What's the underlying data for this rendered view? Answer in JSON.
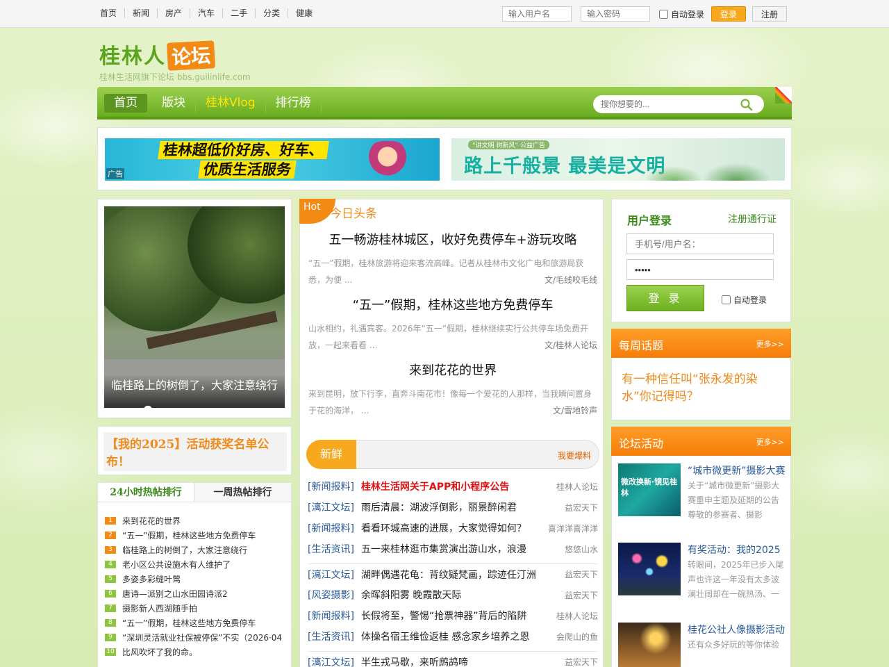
{
  "topbar": {
    "nav": [
      "首页",
      "新闻",
      "房产",
      "汽车",
      "二手",
      "分类",
      "健康"
    ],
    "username_placeholder": "输入用户名",
    "password_placeholder": "输入密码",
    "auto_login": "自动登录",
    "login": "登录",
    "register": "注册"
  },
  "logo": {
    "name": "桂林人",
    "badge": "论坛",
    "subtitle": "桂林生活网旗下论坛",
    "domain": "bbs.guilinlife.com"
  },
  "mainnav": {
    "items": [
      "首页",
      "版块",
      "桂林Vlog",
      "排行榜"
    ],
    "search_placeholder": "搜你想要的..."
  },
  "ads": {
    "ad1_line1": "桂林超低价好房、好车、",
    "ad1_line2": "优质生活服务",
    "ad1_tag": "广告",
    "ad2_caption": "“讲文明 树新风” 公益广告",
    "ad2_text": "路上千般景  最美是文明"
  },
  "slider": {
    "caption": "临桂路上的树倒了，大家注意绕行",
    "dots": 8,
    "active_dot": 2
  },
  "activity_banner": "【我的2025】活动获奖名单公布！",
  "hotlist": {
    "tabs": [
      "24小时热帖排行",
      "一周热帖排行"
    ],
    "items": [
      {
        "n": "1",
        "t": "来到花花的世界"
      },
      {
        "n": "2",
        "t": "“五一”假期，桂林这些地方免费停车"
      },
      {
        "n": "3",
        "t": "临桂路上的树倒了，大家注意绕行"
      },
      {
        "n": "4",
        "t": "老小区公共设施木有人维护了"
      },
      {
        "n": "5",
        "t": "多姿多彩缝叶莺"
      },
      {
        "n": "6",
        "t": "唐诗—派别之山水田园诗派2"
      },
      {
        "n": "7",
        "t": "摄影新人西湖随手拍"
      },
      {
        "n": "8",
        "t": "“五一”假期，桂林这些地方免费停车"
      },
      {
        "n": "9",
        "t": "“深圳灵活就业社保被停保”不实（2026·04"
      },
      {
        "n": "10",
        "t": "比风吹坏了我的命。"
      }
    ]
  },
  "headlines": {
    "badge": "Hot",
    "title": "今日头条",
    "items": [
      {
        "title": "五一畅游桂林城区，收好免费停车+游玩攻略",
        "desc": "“五一”假期，桂林旅游将迎来客流高峰。记者从桂林市文化广电和旅游局获悉，为便 ...",
        "author": "文/毛线咬毛线"
      },
      {
        "title": "“五一”假期，桂林这些地方免费停车",
        "desc": "山水相约，礼遇宾客。2026年“五一”假期，桂林继续实行公共停车场免费开放，一起来看看 ...",
        "author": "文/桂林人论坛"
      },
      {
        "title": "来到花花的世界",
        "desc": "来到昆明，放下行李，直奔斗南花市！像每一个爱花的人那样，当我瞬间置身于花的海洋， ...",
        "author": "文/雪地铃声"
      }
    ]
  },
  "fresh": {
    "label": "新鲜",
    "link": "我要爆料"
  },
  "posts": [
    {
      "cat": "[新闻报料]",
      "title": "桂林生活网关于APP和小程序公告",
      "author": "桂林人论坛",
      "red": true
    },
    {
      "cat": "[漓江文坛]",
      "title": "雨后清晨：湖波浮倒影，丽景醉闲君",
      "author": "益宏天下"
    },
    {
      "cat": "[新闻报料]",
      "title": "看看环城高速的进展，大家觉得如何？",
      "author": "喜洋洋喜洋洋"
    },
    {
      "cat": "[生活资讯]",
      "title": "五一来桂林逛市集赏演出游山水，浪漫",
      "author": "悠悠山水"
    },
    {
      "cat": "[漓江文坛]",
      "title": "湖畔偶遇花龟：背纹疑梵画，踪迹任汀洲",
      "author": "益宏天下"
    },
    {
      "cat": "[风姿摄影]",
      "title": "余晖斜阳雾 晚霞散天际",
      "author": "益宏天下"
    },
    {
      "cat": "[新闻报料]",
      "title": "长假将至，警惕“抢票神器”背后的陷阱",
      "author": "桂林人论坛"
    },
    {
      "cat": "[生活资讯]",
      "title": "体操名宿王维俭返桂 感念家乡培养之恩",
      "author": "会爬山的鱼"
    },
    {
      "cat": "[漓江文坛]",
      "title": "半生戎马歇，来听鹧鸪啼",
      "author": "益宏天下"
    }
  ],
  "login": {
    "title": "用户登录",
    "register": "注册通行证",
    "username_placeholder": "手机号/用户名：",
    "password_value": "•••••",
    "button": "登 录",
    "auto_login": "自动登录"
  },
  "weekly": {
    "title": "每周话题",
    "more": "更多>>",
    "topic": "有一种信任叫“张永发的染水”你记得吗？"
  },
  "forum_activity": {
    "title": "论坛活动",
    "more": "更多>>",
    "items": [
      {
        "title": "“城市微更新”摄影大赛",
        "desc": "关于“城市微更新”摄影大赛重申主题及延期的公告 尊敬的参赛者、摄影",
        "pic_text": "微改换新·镜见桂林"
      },
      {
        "title": "有奖活动：我的2025",
        "desc": "转眼间，2025年已步入尾声也许这一年没有太多波澜壮阔却在一碗热汤、一"
      },
      {
        "title": "桂花公社人像摄影活动",
        "desc": "还有众多好玩的等你体验"
      }
    ]
  },
  "colors": {
    "green": "#6aac1f",
    "orange": "#f28a14",
    "link_blue": "#2a5a9a"
  }
}
